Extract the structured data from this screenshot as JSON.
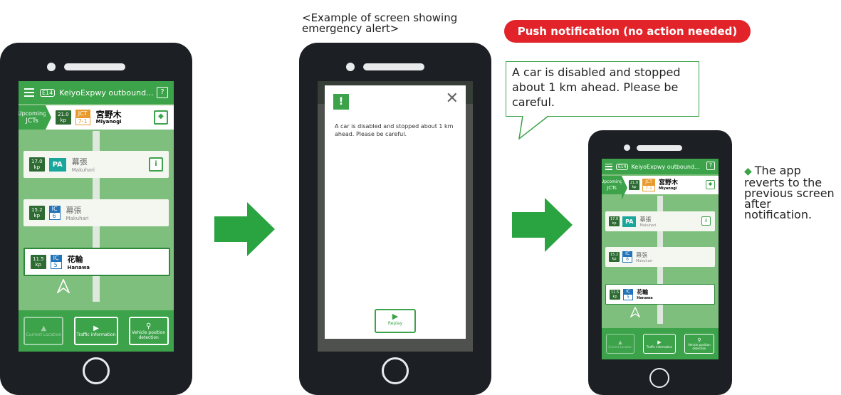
{
  "app": {
    "road_code": "E14",
    "title": "KeiyoExpwy outbound...",
    "help": "?",
    "upcoming": [
      "Upcoming",
      "JCTs"
    ],
    "jct": {
      "kp": "21.0",
      "kp_unit": "kp",
      "type": "JCT",
      "num": "7-1",
      "name_ja": "宮野木",
      "name_en": "Miyanogi"
    },
    "facilities": [
      {
        "kp": "17.0",
        "kp_unit": "kp",
        "type": "PA",
        "name_ja": "幕張",
        "name_en": "Makuhari",
        "info": "i"
      },
      {
        "kp": "15.2",
        "kp_unit": "kp",
        "type": "IC",
        "num": "6",
        "name_ja": "幕張",
        "name_en": "Makuhari"
      },
      {
        "kp": "11.5",
        "kp_unit": "kp",
        "type": "IC",
        "num": "5",
        "name_ja": "花輪",
        "name_en": "Hanawa"
      }
    ],
    "buttons": {
      "current": "Current Location",
      "traffic": "Traffic information",
      "vehicle": "Vehicle position detection"
    }
  },
  "caption": "<Example of screen showing emergency alert>",
  "alert": {
    "message": "A car is disabled and stopped about 1 km ahead. Please be careful.",
    "replay": "Replay",
    "close": "✕",
    "warn": "!"
  },
  "push": {
    "label": "Push notification (no action needed)",
    "message": "A car is disabled and stopped about 1 km ahead. Please be careful."
  },
  "note": "The app reverts to the previous screen after notification.",
  "colors": {
    "green": "#3ca34a",
    "dark_green": "#2d6b33",
    "red": "#e2242a",
    "arrow": "#2aa341",
    "ic_blue": "#2273b8",
    "pa_teal": "#1aa69a",
    "jct_orange": "#e89a2c"
  }
}
